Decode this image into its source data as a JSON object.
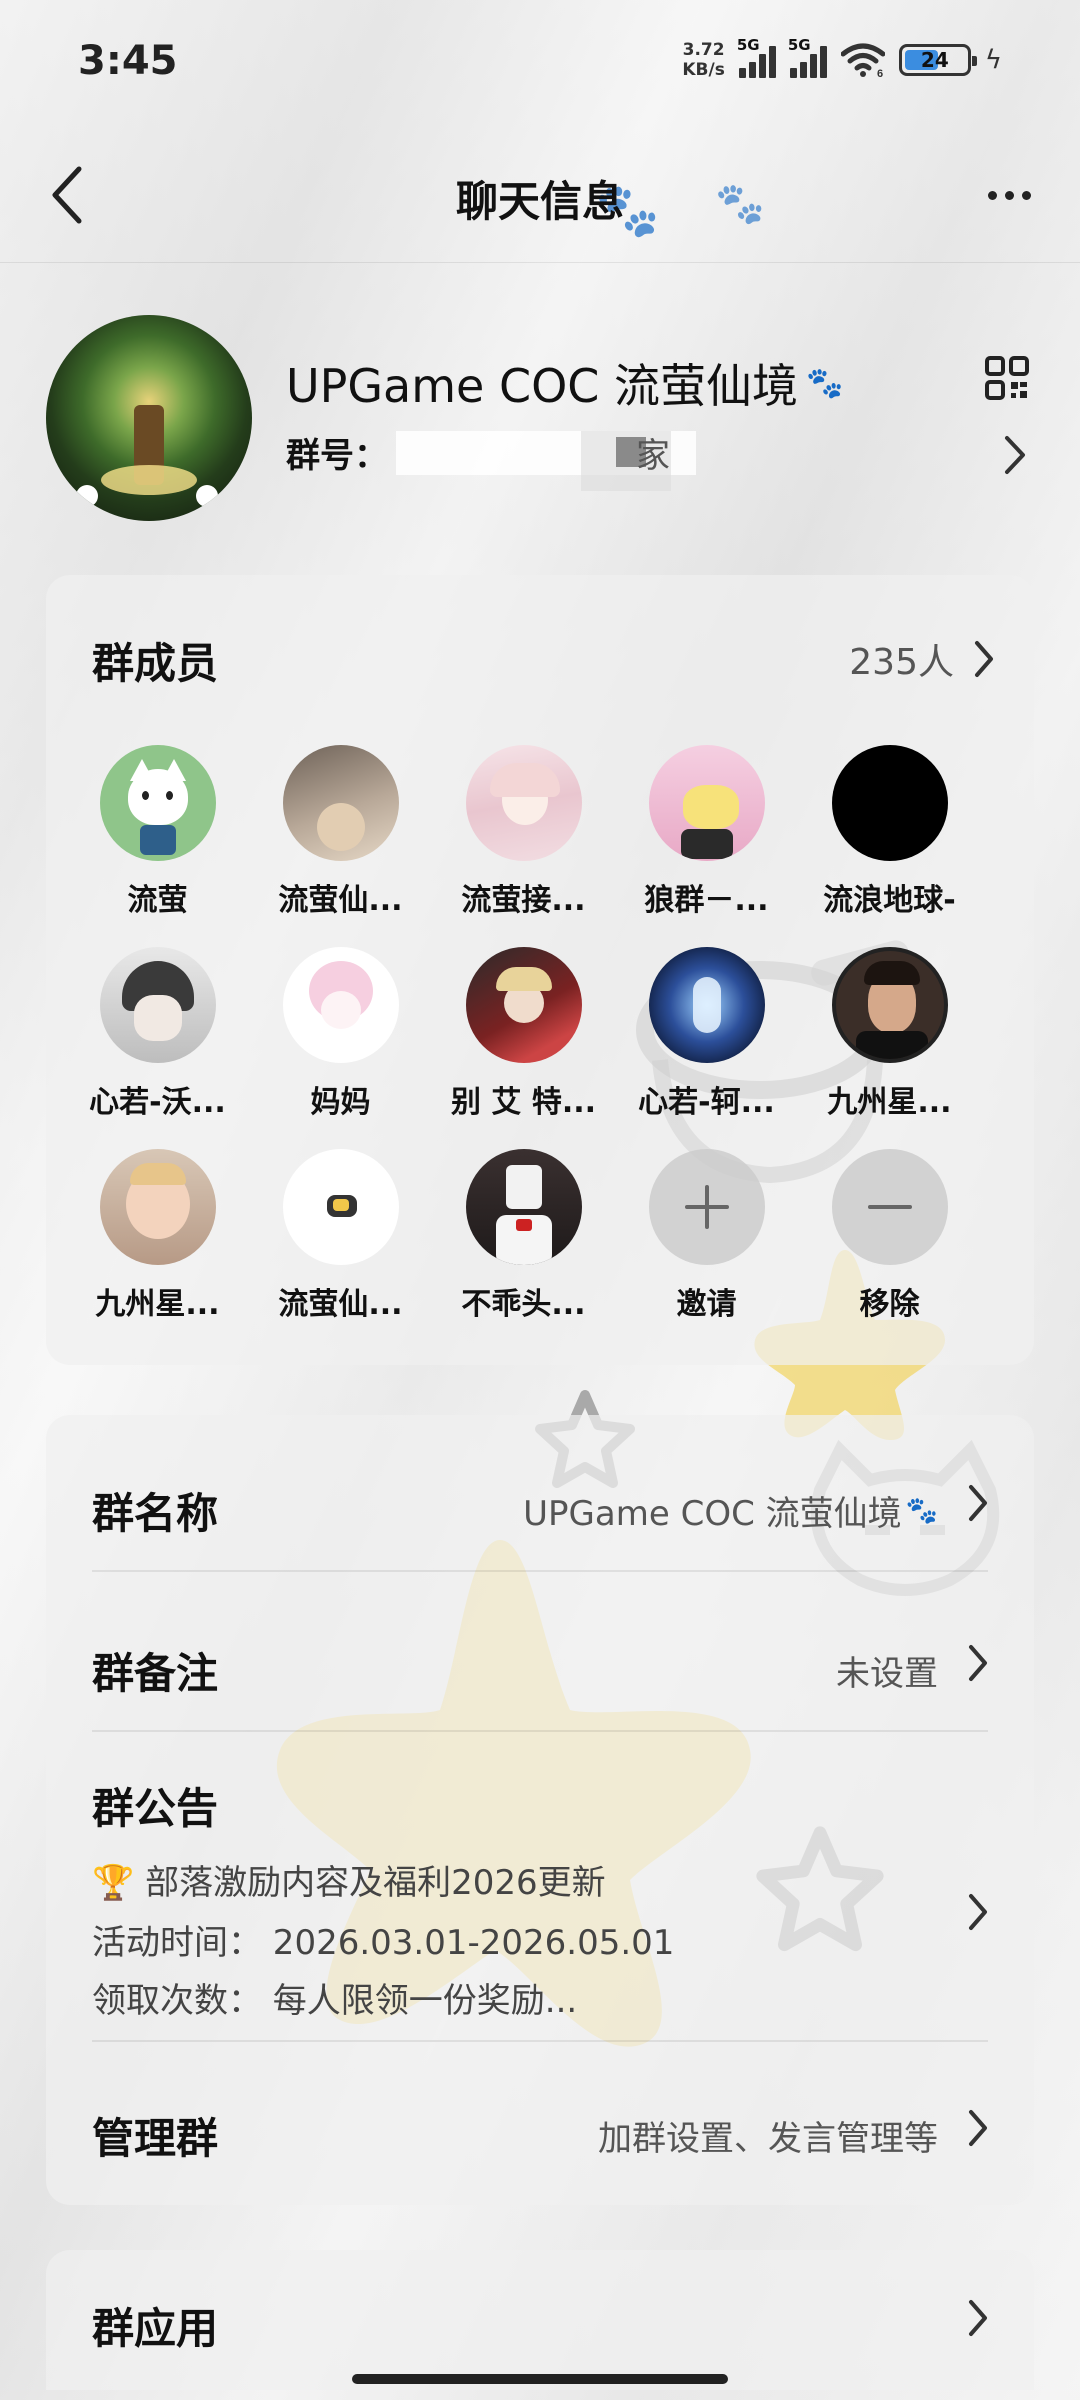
{
  "status_bar": {
    "time": "3:45",
    "net_speed_value": "3.72",
    "net_speed_unit": "KB/s",
    "signal1_label": "5G",
    "signal2_label": "5G",
    "wifi_sub": "6",
    "battery": "24"
  },
  "nav": {
    "title": "聊天信息"
  },
  "group": {
    "name": "UPGame COC 流萤仙境",
    "id_label": "群号：",
    "id_value_partial": "家"
  },
  "members_section": {
    "title": "群成员",
    "count": "235人",
    "members": [
      {
        "name": "流萤"
      },
      {
        "name": "流萤仙..."
      },
      {
        "name": "流萤接..."
      },
      {
        "name": "狼群－..."
      },
      {
        "name": "流浪地球-"
      },
      {
        "name": "心若-沃..."
      },
      {
        "name": "妈妈"
      },
      {
        "name": "别 艾 特..."
      },
      {
        "name": "心若-轲..."
      },
      {
        "name": "九州星..."
      },
      {
        "name": "九州星..."
      },
      {
        "name": "流萤仙..."
      },
      {
        "name": "不乖头..."
      }
    ],
    "invite_label": "邀请",
    "remove_label": "移除"
  },
  "settings": {
    "group_name_label": "群名称",
    "group_name_value": "UPGame COC 流萤仙境",
    "group_remark_label": "群备注",
    "group_remark_value": "未设置",
    "announcement_label": "群公告",
    "announcement_line1": "🏆 部落激励内容及福利2026更新",
    "announcement_line2": "活动时间： 2026.03.01-2026.05.01",
    "announcement_line3": "领取次数： 每人限领一份奖励...",
    "manage_label": "管理群",
    "manage_value": "加群设置、发言管理等",
    "apps_label": "群应用"
  },
  "colors": {
    "accent_battery": "#3b8de0",
    "sticker_star": "#f2d56a"
  }
}
